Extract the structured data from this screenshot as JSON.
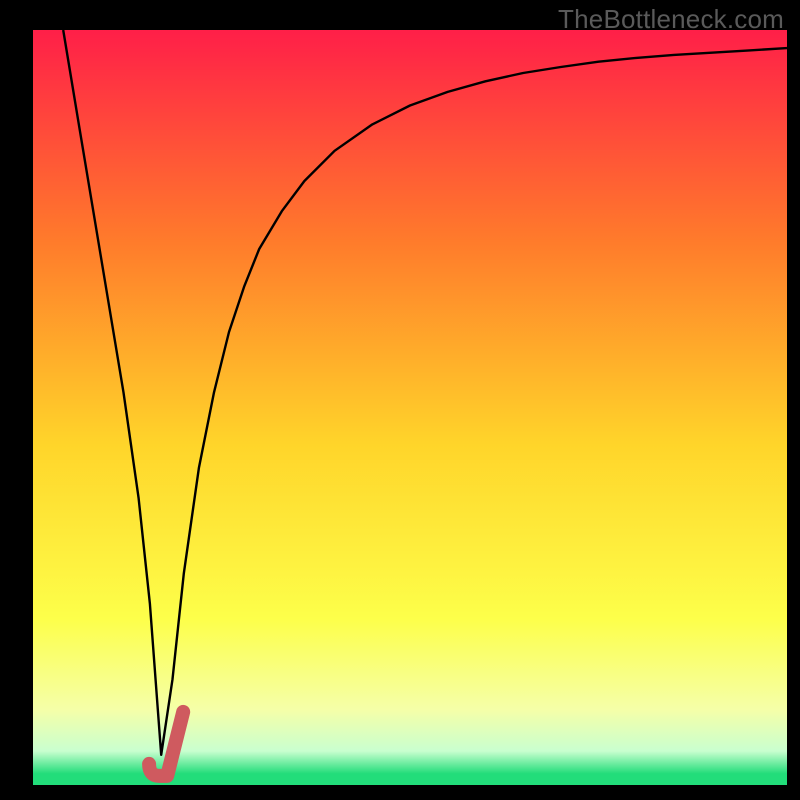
{
  "watermark": "TheBottleneck.com",
  "colors": {
    "frame": "#000000",
    "gradient_top": "#ff1f48",
    "gradient_mid1": "#ff7b2b",
    "gradient_mid2": "#ffd52a",
    "gradient_mid3": "#fdff4a",
    "gradient_bottom1": "#f5ffa8",
    "gradient_bottom2": "#c9ffcf",
    "gradient_green": "#22dd7a",
    "curve": "#000000",
    "tick": "#cf5a5f"
  },
  "chart_data": {
    "type": "line",
    "title": "",
    "xlabel": "",
    "ylabel": "",
    "xlim": [
      0,
      100
    ],
    "ylim": [
      0,
      100
    ],
    "tick_marker": {
      "x": 17,
      "y": 2
    },
    "annotations": [
      "TheBottleneck.com"
    ],
    "series": [
      {
        "name": "bottleneck-curve",
        "x": [
          4,
          6,
          8,
          10,
          12,
          14,
          15.5,
          17,
          18.5,
          20,
          22,
          24,
          26,
          28,
          30,
          33,
          36,
          40,
          45,
          50,
          55,
          60,
          65,
          70,
          75,
          80,
          85,
          90,
          95,
          100
        ],
        "y": [
          100,
          88,
          76,
          64,
          52,
          38,
          24,
          4,
          14,
          28,
          42,
          52,
          60,
          66,
          71,
          76,
          80,
          84,
          87.5,
          90,
          91.8,
          93.2,
          94.3,
          95.1,
          95.8,
          96.3,
          96.7,
          97,
          97.3,
          97.6
        ]
      }
    ]
  }
}
